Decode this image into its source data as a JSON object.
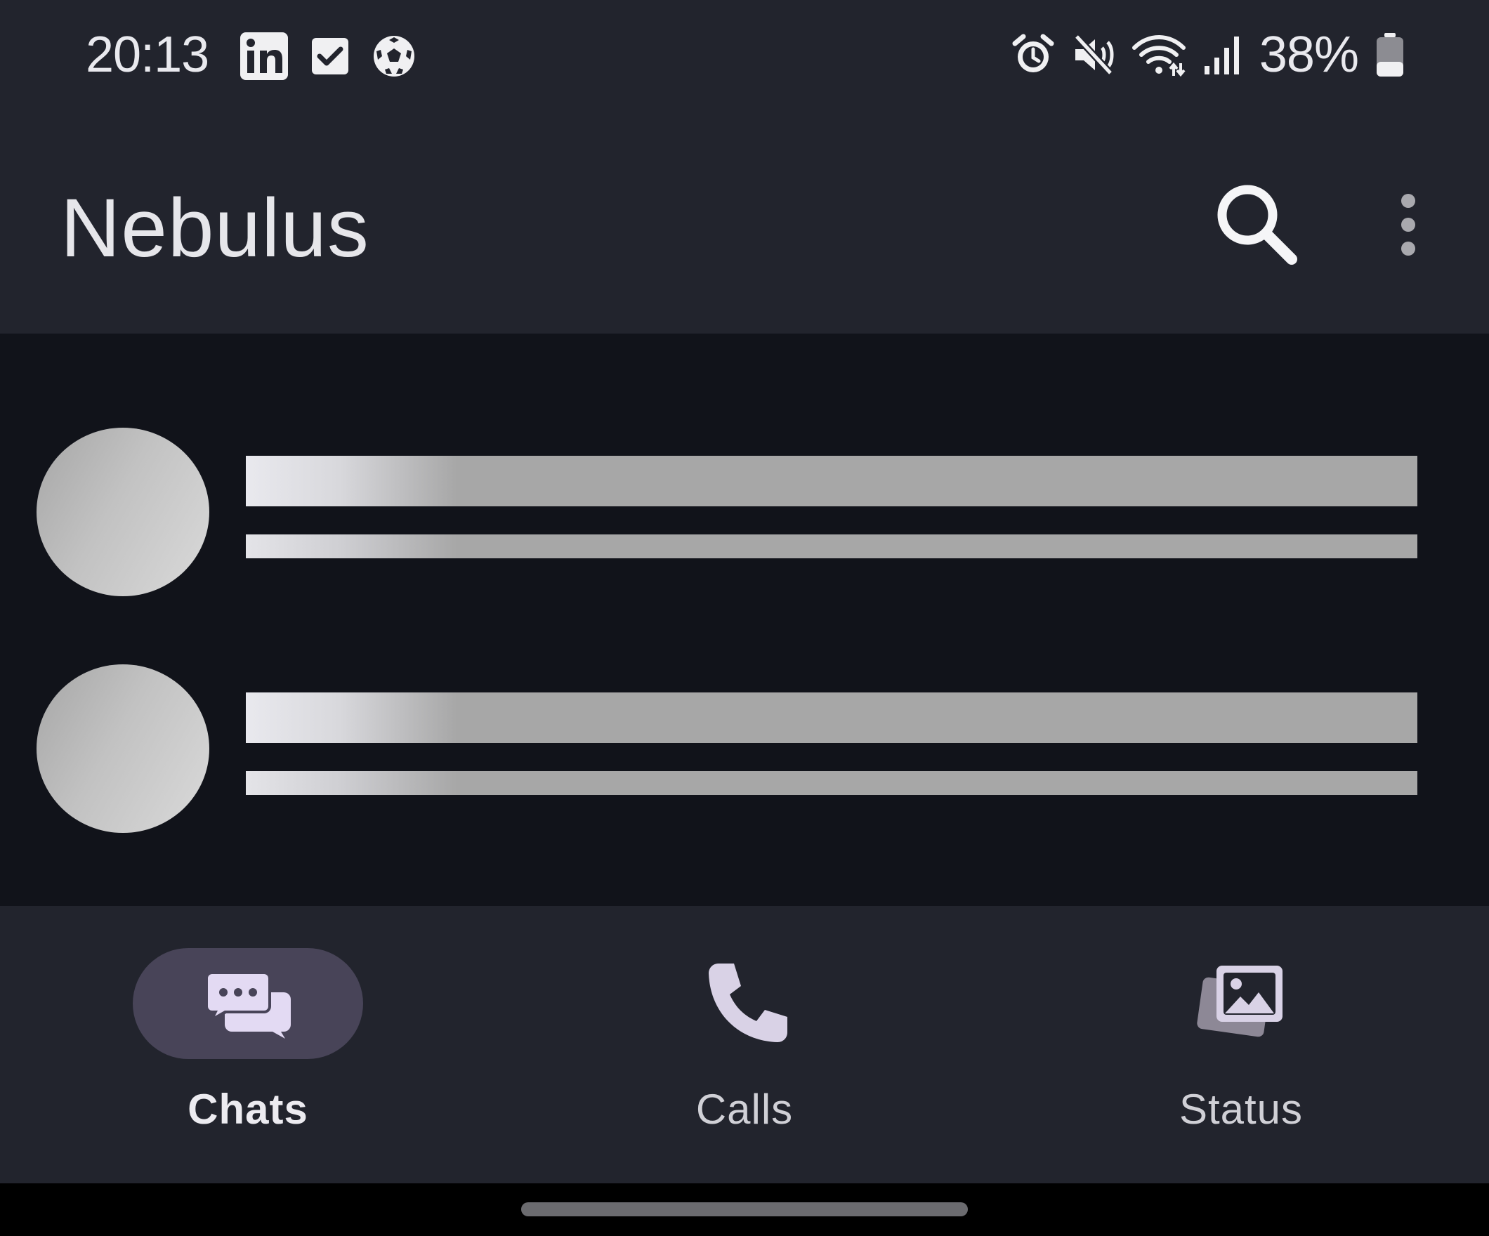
{
  "status_bar": {
    "time": "20:13",
    "battery_percent": "38%",
    "battery_level": 0.38,
    "left_icons": [
      "linkedin-icon",
      "checkbox-icon",
      "soccer-ball-icon"
    ],
    "right_icons": [
      "alarm-icon",
      "mute-icon",
      "wifi-icon",
      "cell-signal-icon",
      "battery-icon"
    ]
  },
  "app_bar": {
    "title": "Nebulus",
    "actions": [
      "search-icon",
      "more-vert-icon"
    ]
  },
  "content": {
    "state": "loading",
    "skeleton_rows": 2
  },
  "bottom_nav": {
    "items": [
      {
        "label": "Chats",
        "icon": "chat-bubbles-icon",
        "active": true
      },
      {
        "label": "Calls",
        "icon": "phone-icon",
        "active": false
      },
      {
        "label": "Status",
        "icon": "photo-gallery-icon",
        "active": false
      }
    ]
  },
  "colors": {
    "surface": "#22242d",
    "background": "#11131a",
    "active_pill": "#484458",
    "icon_tint": "#e3daf3",
    "skeleton": "#a7a7a7"
  }
}
